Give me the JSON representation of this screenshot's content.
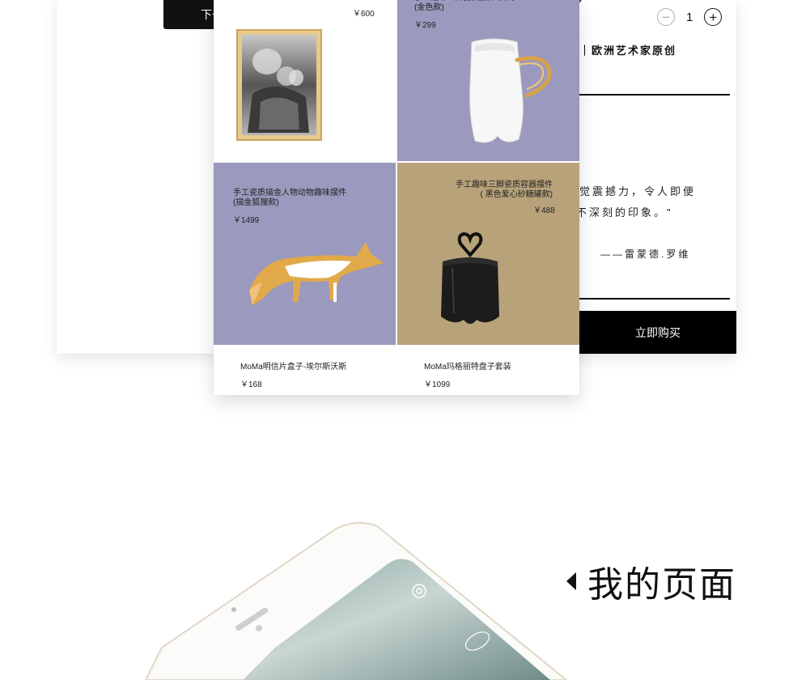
{
  "back_card": {
    "next_label": "下一",
    "quantity": "1",
    "minus": "−",
    "plus": "+",
    "artist_line": "｜欧洲艺术家原创",
    "quote_line1": "觉震撼力，令人即便",
    "quote_line2": "不深刻的印象。\"",
    "quote_author": "——雷蒙德.罗维",
    "buy_label": "立即购买"
  },
  "products": [
    {
      "name": "…",
      "price": "￥600"
    },
    {
      "name": "手工趣味三脚瓷质摆件·款式\n(金色款)",
      "price": "￥299"
    },
    {
      "name": "手工瓷质描金人物动物趣味摆件\n(描金狐狸款)",
      "price": "￥1499"
    },
    {
      "name": "手工趣味三脚瓷质容器摆件\n( 黑色爱心砂糖罐款)",
      "price": "￥488"
    },
    {
      "name": "MoMa明信片盒子-埃尔斯沃斯",
      "price": "￥168"
    },
    {
      "name": "MoMa玛格丽特盘子套装",
      "price": "￥1099"
    }
  ],
  "section": {
    "title": "我的页面"
  },
  "icons": {
    "settings": "gear-icon",
    "edit": "edit-badge-icon",
    "back": "triangle-left-icon"
  },
  "colors": {
    "lavender": "#9b99bd",
    "tan": "#b8a27a",
    "black": "#000000"
  }
}
